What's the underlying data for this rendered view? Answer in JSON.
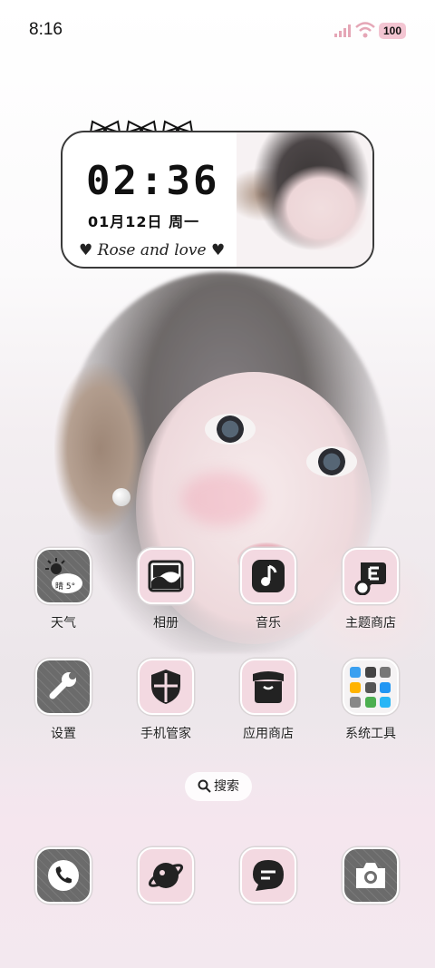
{
  "status": {
    "time": "8:16",
    "battery": "100"
  },
  "widget": {
    "time": "02:36",
    "date": "01月12日 周一",
    "script_text": "Rose and love"
  },
  "weather": {
    "condition": "晴",
    "temperature": "5°"
  },
  "apps": {
    "row1": [
      {
        "label": "天气",
        "icon": "weather-icon"
      },
      {
        "label": "相册",
        "icon": "gallery-icon"
      },
      {
        "label": "音乐",
        "icon": "music-icon"
      },
      {
        "label": "主题商店",
        "icon": "theme-store-icon"
      }
    ],
    "row2": [
      {
        "label": "设置",
        "icon": "wrench-icon"
      },
      {
        "label": "手机管家",
        "icon": "shield-icon"
      },
      {
        "label": "应用商店",
        "icon": "store-icon"
      },
      {
        "label": "系统工具",
        "icon": "folder-icon"
      }
    ]
  },
  "search_label": "搜索",
  "dock": [
    {
      "icon": "phone-icon"
    },
    {
      "icon": "browser-icon"
    },
    {
      "icon": "message-icon"
    },
    {
      "icon": "camera-icon"
    }
  ],
  "colors": {
    "accent_pink": "#f3d9e1",
    "icon_dark": "#6f6f6f",
    "battery_bg": "#f3c5d2"
  }
}
